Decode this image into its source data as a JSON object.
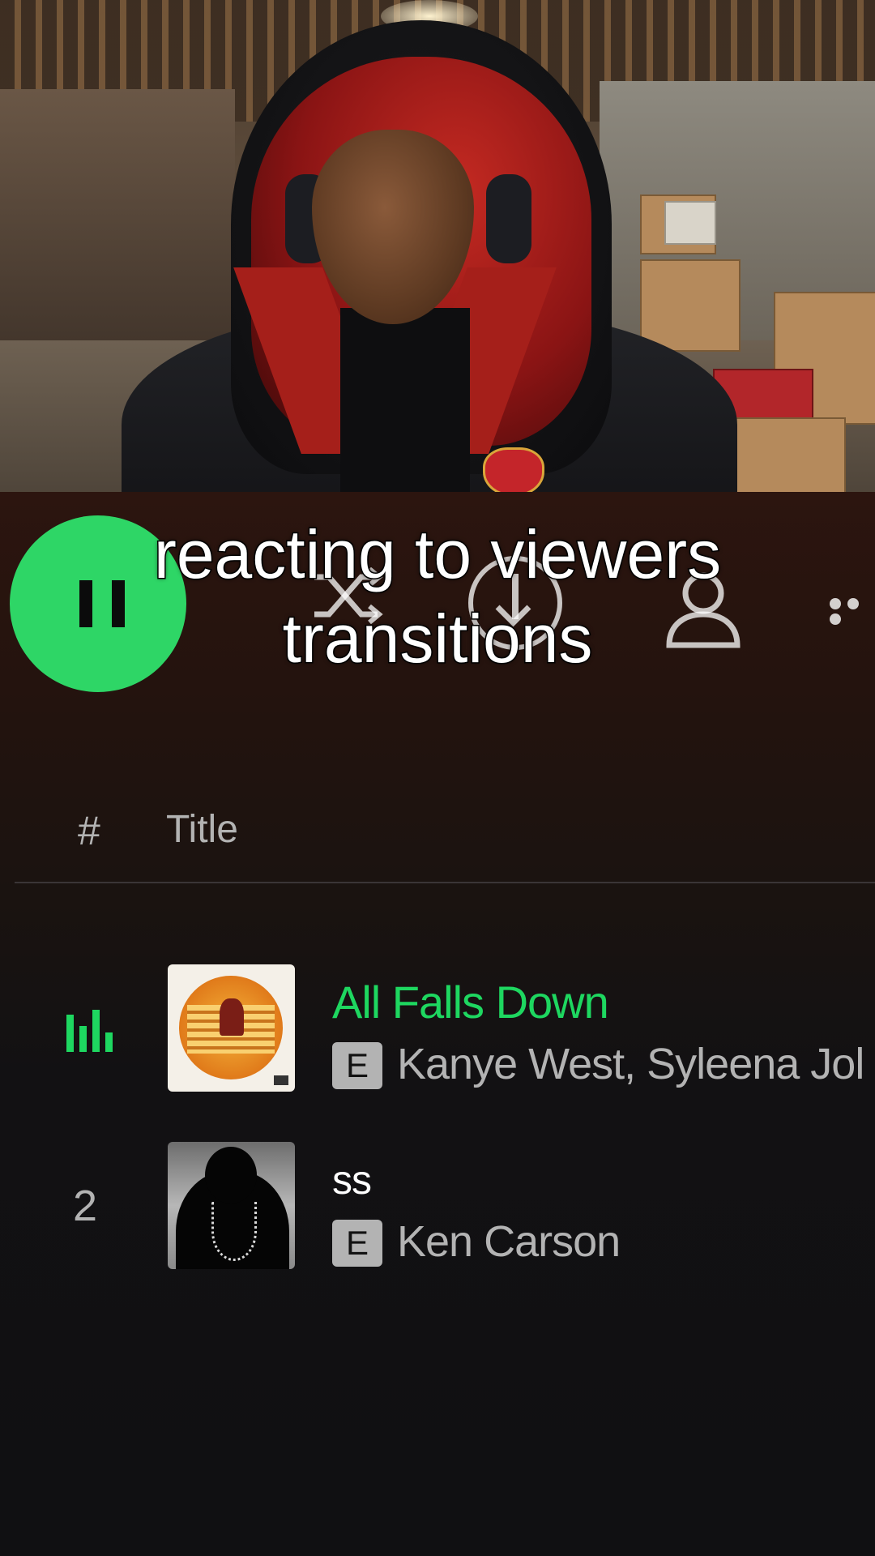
{
  "caption": {
    "line1": "reacting to viewers",
    "line2": "transitions"
  },
  "toolbar": {
    "play_state": "playing",
    "icons": [
      "pause-icon",
      "shuffle-icon",
      "download-icon",
      "user-icon",
      "more-icon"
    ]
  },
  "tracklist": {
    "header": {
      "number_label": "#",
      "title_label": "Title"
    },
    "rows": [
      {
        "number": "",
        "playing": true,
        "title": "All Falls Down",
        "explicit_label": "E",
        "artists": "Kanye West, Syleena Jol"
      },
      {
        "number": "2",
        "playing": false,
        "title": "ss",
        "explicit_label": "E",
        "artists": "Ken Carson"
      }
    ]
  },
  "colors": {
    "spotify_green": "#1ed760",
    "play_button": "#2ed666",
    "muted_text": "#b3b3b3",
    "background": "#101012"
  }
}
